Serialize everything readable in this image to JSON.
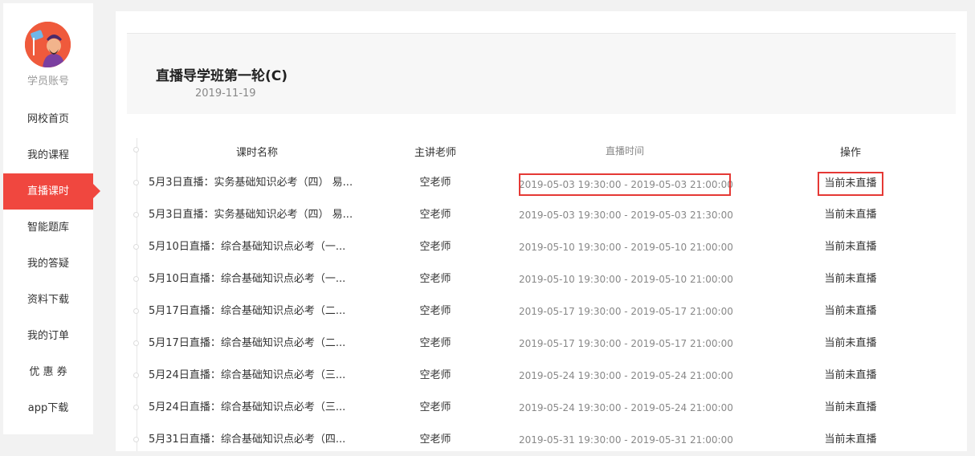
{
  "sidebar": {
    "account_label": "学员账号",
    "items": [
      {
        "label": "网校首页"
      },
      {
        "label": "我的课程"
      },
      {
        "label": "直播课时"
      },
      {
        "label": "智能题库"
      },
      {
        "label": "我的答疑"
      },
      {
        "label": "资料下载"
      },
      {
        "label": "我的订单"
      },
      {
        "label": "优 惠 券"
      },
      {
        "label": "app下载"
      }
    ],
    "active_index": 2,
    "active_color": "#f0473f"
  },
  "course": {
    "title": "直播导学班第一轮(C)",
    "date": "2019-11-19"
  },
  "table": {
    "headers": {
      "name": "课时名称",
      "teacher": "主讲老师",
      "time": "直播时间",
      "action": "操作"
    },
    "rows": [
      {
        "name": "5月3日直播：实务基础知识必考（四） 易...",
        "teacher": "空老师",
        "time": "2019-05-03 19:30:00 - 2019-05-03 21:00:00",
        "action": "当前未直播"
      },
      {
        "name": "5月3日直播：实务基础知识必考（四） 易...",
        "teacher": "空老师",
        "time": "2019-05-03 19:30:00 - 2019-05-03 21:30:00",
        "action": "当前未直播"
      },
      {
        "name": "5月10日直播：综合基础知识点必考（一...",
        "teacher": "空老师",
        "time": "2019-05-10 19:30:00 - 2019-05-10 21:00:00",
        "action": "当前未直播"
      },
      {
        "name": "5月10日直播：综合基础知识点必考（一...",
        "teacher": "空老师",
        "time": "2019-05-10 19:30:00 - 2019-05-10 21:00:00",
        "action": "当前未直播"
      },
      {
        "name": "5月17日直播：综合基础知识点必考（二...",
        "teacher": "空老师",
        "time": "2019-05-17 19:30:00 - 2019-05-17 21:00:00",
        "action": "当前未直播"
      },
      {
        "name": "5月17日直播：综合基础知识点必考（二...",
        "teacher": "空老师",
        "time": "2019-05-17 19:30:00 - 2019-05-17 21:00:00",
        "action": "当前未直播"
      },
      {
        "name": "5月24日直播：综合基础知识点必考（三...",
        "teacher": "空老师",
        "time": "2019-05-24 19:30:00 - 2019-05-24 21:00:00",
        "action": "当前未直播"
      },
      {
        "name": "5月24日直播：综合基础知识点必考（三...",
        "teacher": "空老师",
        "time": "2019-05-24 19:30:00 - 2019-05-24 21:00:00",
        "action": "当前未直播"
      },
      {
        "name": "5月31日直播：综合基础知识点必考（四...",
        "teacher": "空老师",
        "time": "2019-05-31 19:30:00 - 2019-05-31 21:00:00",
        "action": "当前未直播"
      }
    ]
  },
  "colors": {
    "highlight_border": "#e53935"
  }
}
